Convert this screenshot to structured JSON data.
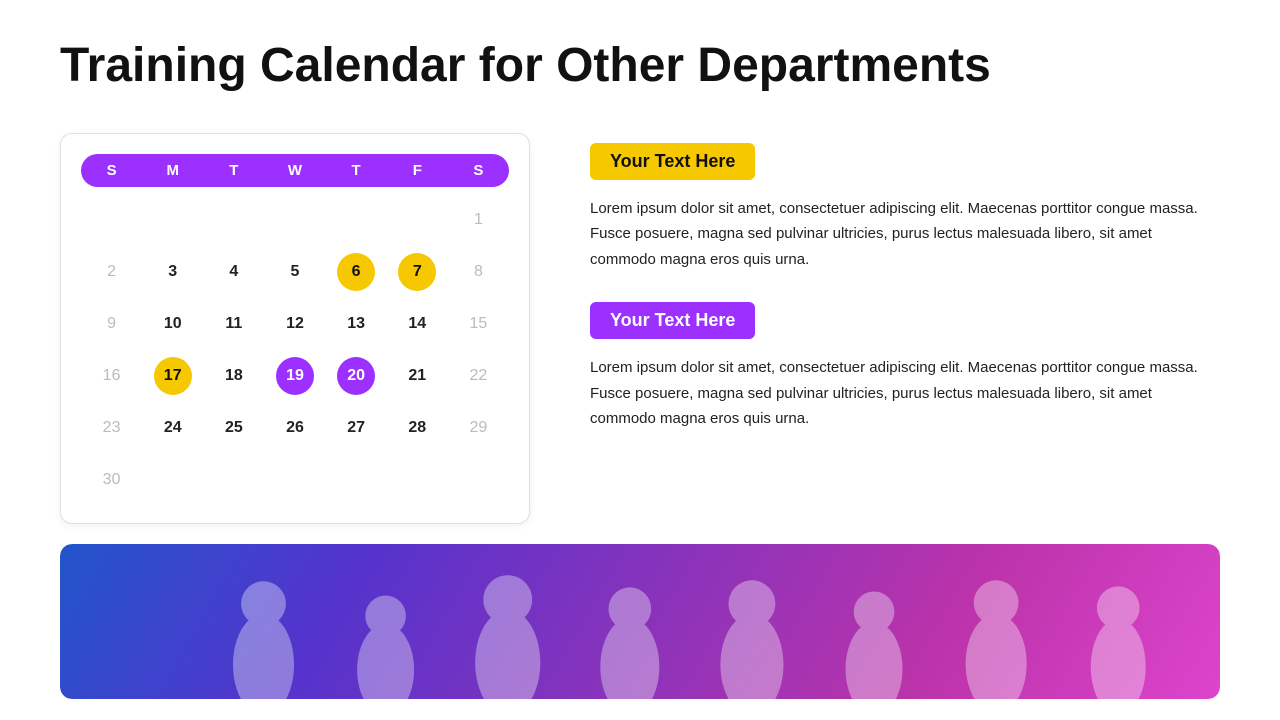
{
  "page": {
    "title": "Training Calendar for Other Departments"
  },
  "calendar": {
    "days_header": [
      "S",
      "M",
      "T",
      "W",
      "T",
      "F",
      "S"
    ],
    "weeks": [
      [
        {
          "num": "",
          "type": "empty"
        },
        {
          "num": "",
          "type": "empty"
        },
        {
          "num": "",
          "type": "empty"
        },
        {
          "num": "",
          "type": "empty"
        },
        {
          "num": "",
          "type": "empty"
        },
        {
          "num": "",
          "type": "empty"
        },
        {
          "num": "1",
          "type": "faded"
        }
      ],
      [
        {
          "num": "2",
          "type": "faded"
        },
        {
          "num": "3",
          "type": "normal"
        },
        {
          "num": "4",
          "type": "normal"
        },
        {
          "num": "5",
          "type": "normal"
        },
        {
          "num": "6",
          "type": "yellow"
        },
        {
          "num": "7",
          "type": "yellow"
        },
        {
          "num": "8",
          "type": "faded"
        }
      ],
      [
        {
          "num": "9",
          "type": "faded"
        },
        {
          "num": "10",
          "type": "normal"
        },
        {
          "num": "11",
          "type": "normal"
        },
        {
          "num": "12",
          "type": "normal"
        },
        {
          "num": "13",
          "type": "normal"
        },
        {
          "num": "14",
          "type": "normal"
        },
        {
          "num": "15",
          "type": "faded"
        }
      ],
      [
        {
          "num": "16",
          "type": "faded"
        },
        {
          "num": "17",
          "type": "yellow"
        },
        {
          "num": "18",
          "type": "normal"
        },
        {
          "num": "19",
          "type": "purple"
        },
        {
          "num": "20",
          "type": "purple"
        },
        {
          "num": "21",
          "type": "normal"
        },
        {
          "num": "22",
          "type": "faded"
        }
      ],
      [
        {
          "num": "23",
          "type": "faded"
        },
        {
          "num": "24",
          "type": "normal"
        },
        {
          "num": "25",
          "type": "normal"
        },
        {
          "num": "26",
          "type": "normal"
        },
        {
          "num": "27",
          "type": "normal"
        },
        {
          "num": "28",
          "type": "normal"
        },
        {
          "num": "29",
          "type": "faded"
        }
      ],
      [
        {
          "num": "30",
          "type": "faded"
        },
        {
          "num": "",
          "type": "empty"
        },
        {
          "num": "",
          "type": "empty"
        },
        {
          "num": "",
          "type": "empty"
        },
        {
          "num": "",
          "type": "empty"
        },
        {
          "num": "",
          "type": "empty"
        },
        {
          "num": "",
          "type": "empty"
        }
      ]
    ]
  },
  "sections": [
    {
      "badge_text": "Your Text Here",
      "badge_color": "yellow",
      "body_text": "Lorem ipsum dolor sit amet, consectetuer adipiscing elit. Maecenas porttitor congue massa. Fusce posuere, magna sed pulvinar ultricies, purus lectus malesuada libero, sit amet commodo magna eros quis urna."
    },
    {
      "badge_text": "Your Text Here",
      "badge_color": "purple",
      "body_text": "Lorem ipsum dolor sit amet, consectetuer adipiscing elit. Maecenas porttitor congue massa. Fusce posuere, magna sed pulvinar ultricies, purus lectus malesuada libero, sit amet commodo magna eros quis urna."
    }
  ]
}
